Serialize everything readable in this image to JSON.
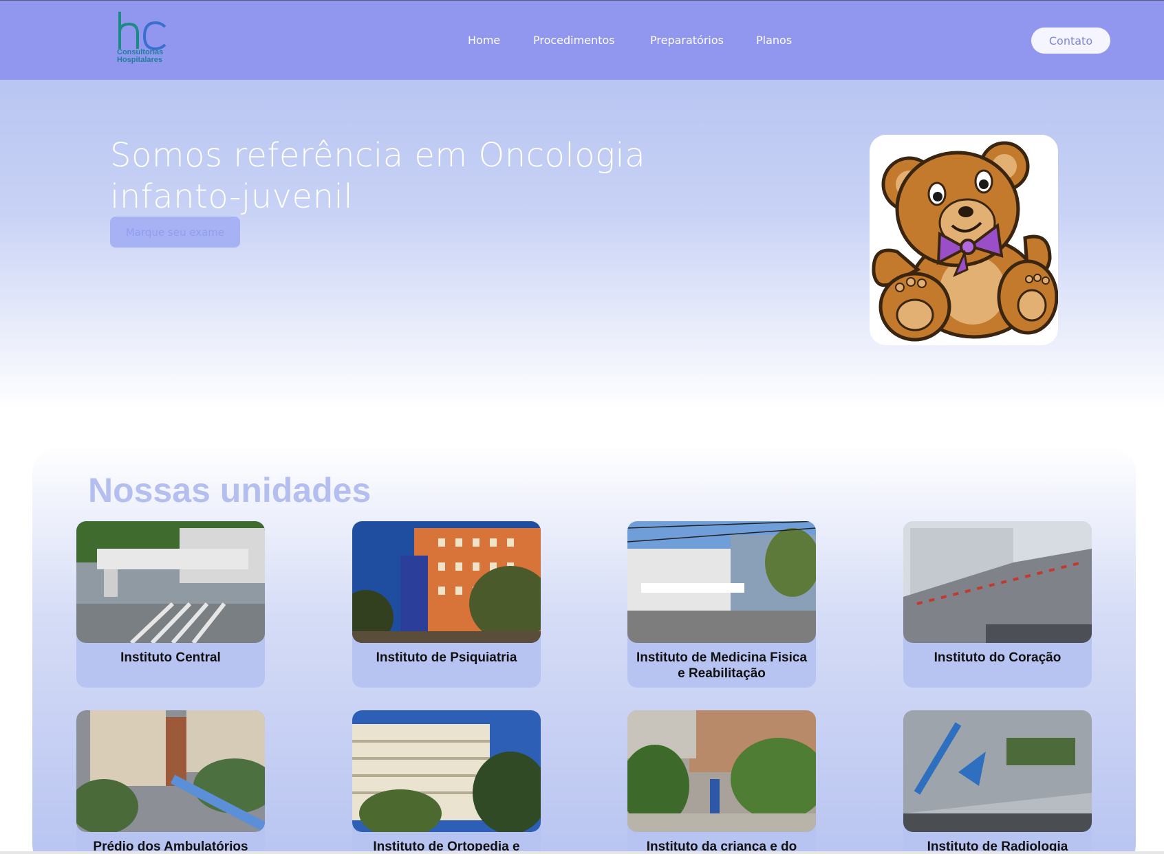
{
  "header": {
    "logo": {
      "mark": "hc",
      "line1": "Consultorias",
      "line2": "Hospitalares"
    },
    "nav": [
      {
        "label": "Home"
      },
      {
        "label": "Procedimentos"
      },
      {
        "label": "Preparatórios"
      },
      {
        "label": "Planos"
      }
    ],
    "contact_label": "Contato"
  },
  "hero": {
    "title_line1": "Somos referência em Oncologia",
    "title_line2": "infanto-juvenil",
    "cta_label": "Marque seu exame",
    "image": "teddy-bear-illustration"
  },
  "units": {
    "title": "Nossas unidades",
    "cards": [
      {
        "label": "Instituto Central",
        "image": "photo-instituto-central"
      },
      {
        "label": "Instituto de Psiquiatria",
        "image": "photo-instituto-psiquiatria"
      },
      {
        "label": "Instituto de Medicina Fisica e Reabilitação",
        "image": "photo-instituto-medicina-fisica"
      },
      {
        "label": "Instituto do Coração",
        "image": "photo-instituto-coracao"
      },
      {
        "label": "Prédio dos Ambulatórios",
        "image": "photo-predio-ambulatorios"
      },
      {
        "label": "Instituto de Ortopedia e",
        "image": "photo-instituto-ortopedia"
      },
      {
        "label": "Instituto da criança e do",
        "image": "photo-instituto-crianca"
      },
      {
        "label": "Instituto de Radiologia",
        "image": "photo-instituto-radiologia"
      }
    ]
  },
  "colors": {
    "header_bg": "#9196ef",
    "hero_gradient_top": "#b9c5f2",
    "card_bg": "#b7c3f1",
    "units_title": "#b4bff0"
  }
}
